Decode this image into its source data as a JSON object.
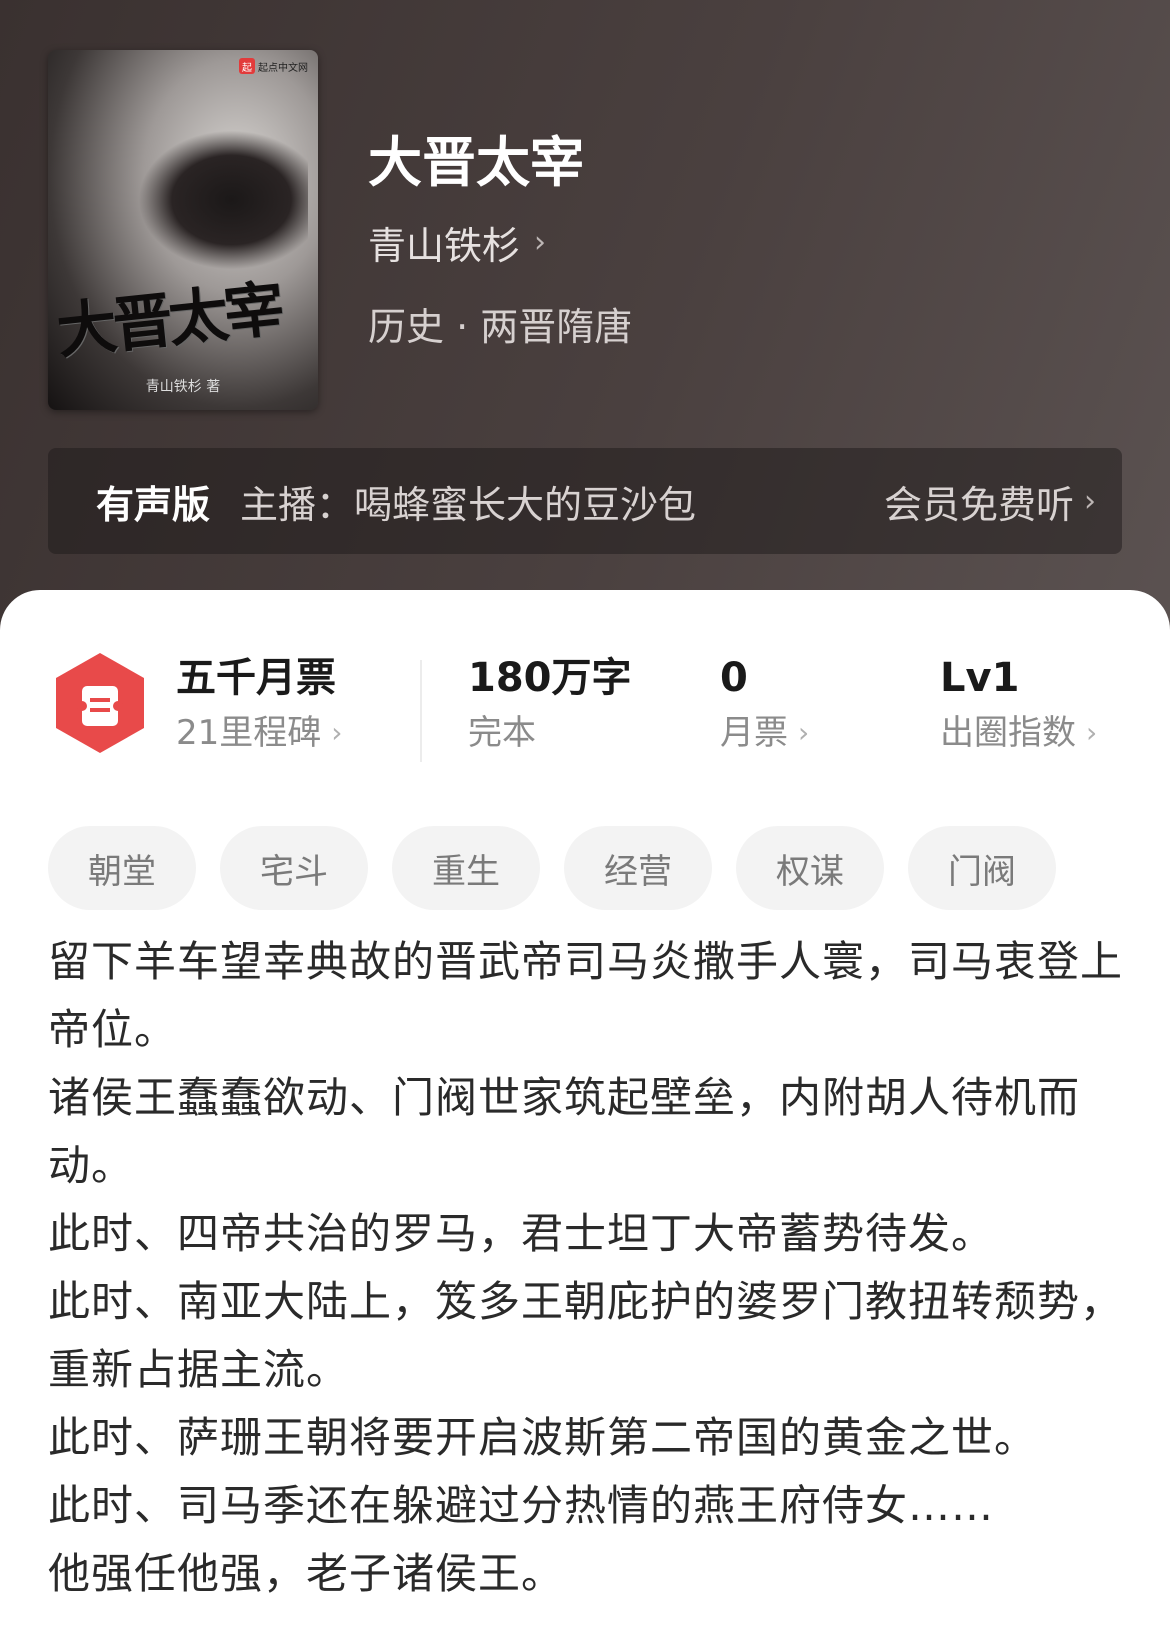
{
  "header": {
    "cover_badge": "起点中文网",
    "cover_title": "大晋太宰",
    "cover_author": "青山铁杉 著",
    "title": "大晋太宰",
    "author": "青山铁杉",
    "category": "历史 · 两晋隋唐"
  },
  "audio": {
    "label": "有声版",
    "host": "主播：喝蜂蜜长大的豆沙包",
    "free": "会员免费听"
  },
  "stats": {
    "milestone_title": "五千月票",
    "milestone_sub": "21里程碑",
    "words": "180万字",
    "status": "完本",
    "monthly_votes": "0",
    "monthly_votes_label": "月票",
    "level": "Lv1",
    "level_label": "出圈指数"
  },
  "tags": [
    "朝堂",
    "宅斗",
    "重生",
    "经营",
    "权谋",
    "门阀"
  ],
  "synopsis": [
    "留下羊车望幸典故的晋武帝司马炎撒手人寰，司马衷登上帝位。",
    "诸侯王蠢蠢欲动、门阀世家筑起壁垒，内附胡人待机而动。",
    "此时、四帝共治的罗马，君士坦丁大帝蓄势待发。",
    "此时、南亚大陆上，笈多王朝庇护的婆罗门教扭转颓势，重新占据主流。",
    "此时、萨珊王朝将要开启波斯第二帝国的黄金之世。",
    "此时、司马季还在躲避过分热情的燕王府侍女……",
    "他强任他强，老子诸侯王。"
  ],
  "colors": {
    "accent_red": "#e84a4a",
    "header_bg": "#3f3736"
  },
  "icons": {
    "milestone": "ticket-hexagon-icon",
    "chevron": "chevron-right-icon"
  }
}
